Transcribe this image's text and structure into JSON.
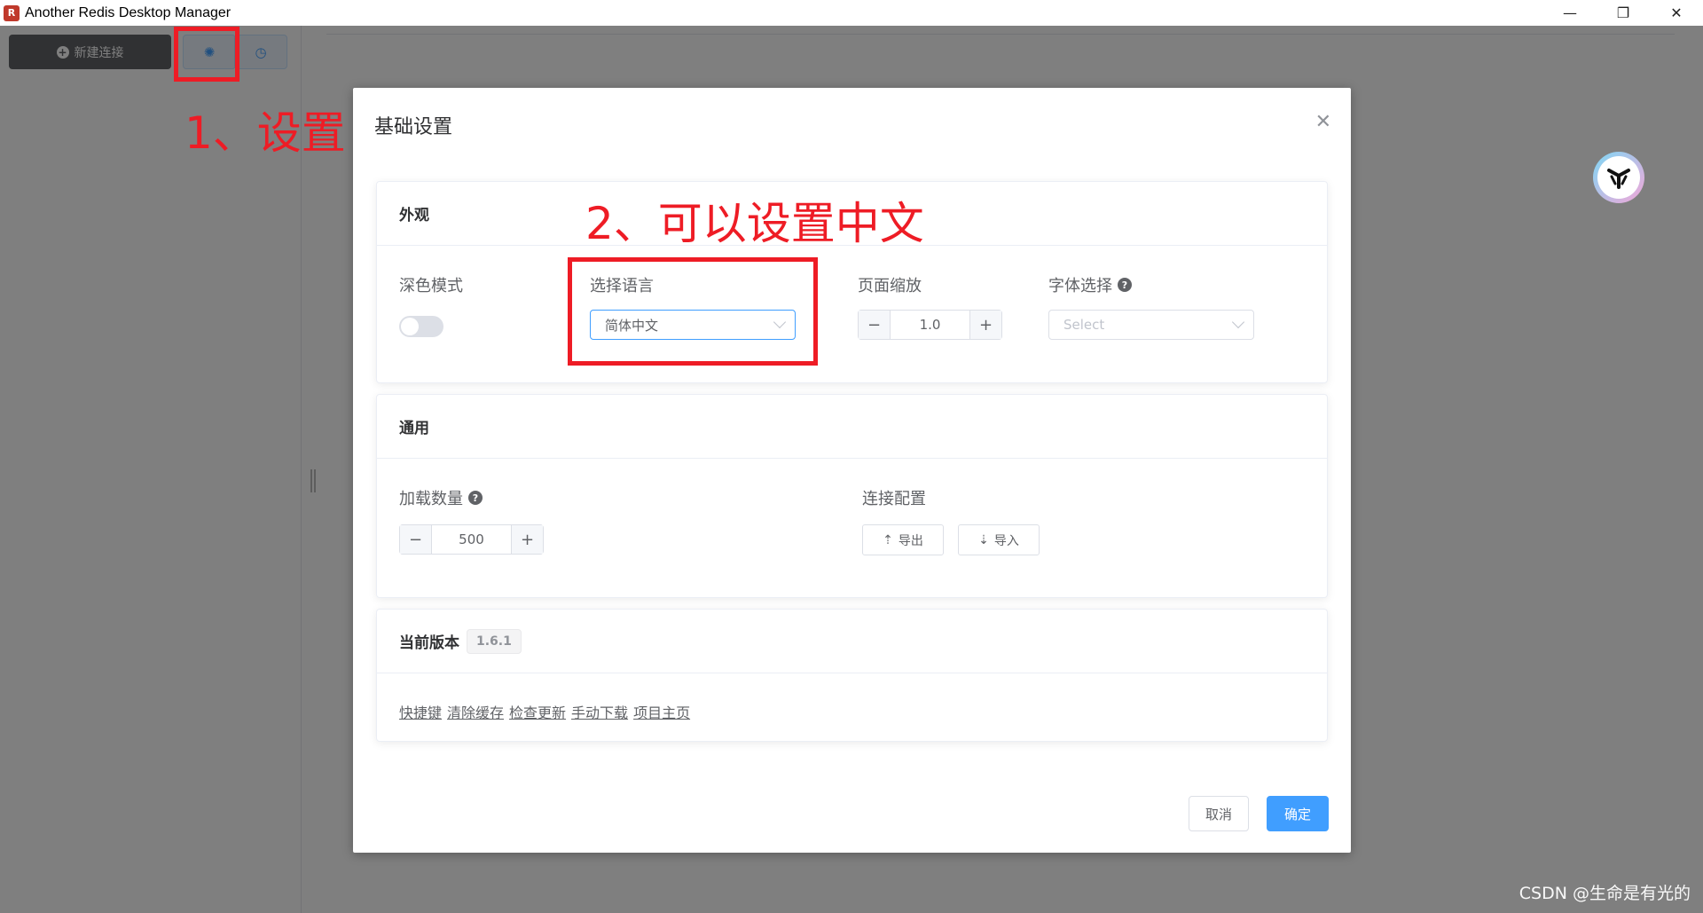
{
  "window": {
    "title": "Another Redis Desktop Manager",
    "logo_text": "R",
    "controls": [
      "—",
      "❐",
      "✕"
    ]
  },
  "sidebar": {
    "new_connection_label": "新建连接",
    "settings_icon": "gear-icon",
    "history_icon": "clock-icon"
  },
  "dialog": {
    "title": "基础设置",
    "close_glyph": "✕",
    "appearance": {
      "header": "外观",
      "dark_mode_label": "深色模式",
      "dark_mode_on": false,
      "language_label": "选择语言",
      "language_value": "简体中文",
      "zoom_label": "页面缩放",
      "zoom_value": "1.0",
      "font_label": "字体选择",
      "font_placeholder": "Select"
    },
    "general": {
      "header": "通用",
      "load_count_label": "加载数量",
      "load_count_value": "500",
      "connection_config_label": "连接配置",
      "export_label": "导出",
      "import_label": "导入"
    },
    "version": {
      "header": "当前版本",
      "tag": "1.6.1",
      "links": [
        "快捷键",
        "清除缓存",
        "检查更新",
        "手动下载",
        "项目主页"
      ]
    },
    "footer": {
      "cancel_label": "取消",
      "confirm_label": "确定"
    }
  },
  "annotations": {
    "step1": "1、设置",
    "step2": "2、可以设置中文",
    "color": "#ee1c25"
  },
  "watermark": "CSDN @生命是有光的",
  "colors": {
    "primary": "#409eff",
    "sidebar_button": "#606266"
  }
}
